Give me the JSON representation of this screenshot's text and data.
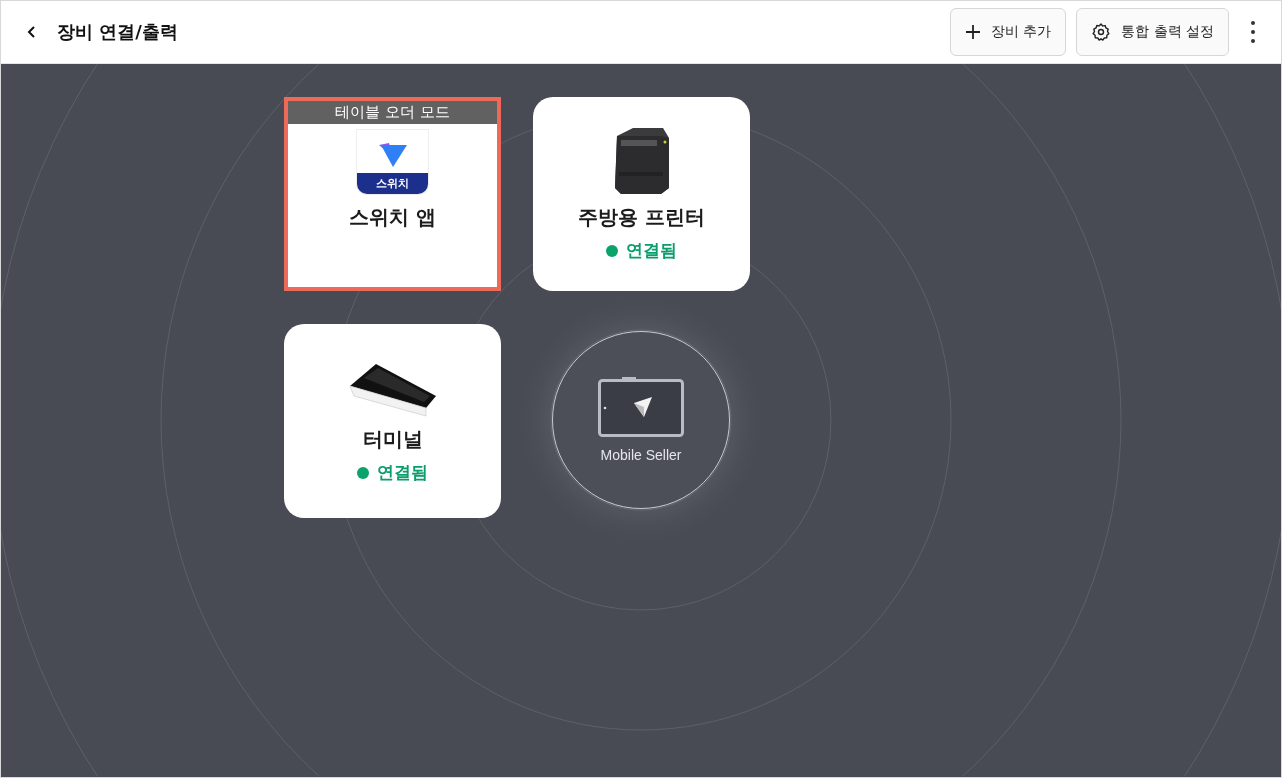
{
  "header": {
    "title": "장비 연결/출력",
    "buttons": [
      {
        "kind": "add",
        "label": "장비 추가"
      },
      {
        "kind": "settings",
        "label": "통합 출력 설정"
      }
    ]
  },
  "devices": [
    {
      "kind": "app",
      "name": "스위치 앱",
      "badge": "테이블 오더 모드",
      "icon_label": "스위치",
      "highlighted": true
    },
    {
      "kind": "printer",
      "name": "주방용 프린터",
      "status": "연결됨",
      "highlighted": false
    },
    {
      "kind": "terminal",
      "name": "터미널",
      "status": "연결됨",
      "highlighted": false
    }
  ],
  "hub": {
    "label": "Mobile Seller"
  }
}
